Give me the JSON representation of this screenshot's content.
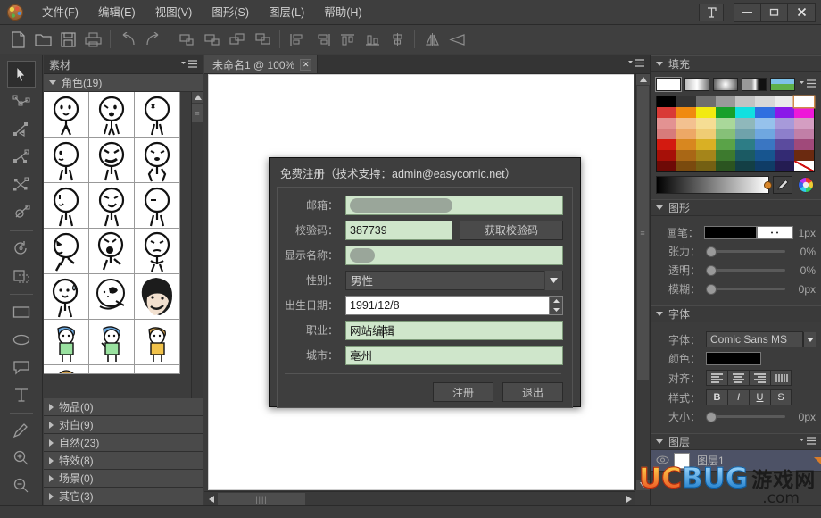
{
  "window": {
    "menu": [
      "文件(F)",
      "编辑(E)",
      "视图(V)",
      "图形(S)",
      "图层(L)",
      "帮助(H)"
    ],
    "controls": {
      "text_tool": "T",
      "minimize": "—",
      "maximize": "□",
      "close": "✕"
    }
  },
  "toolbar": {
    "icons": [
      "new-file",
      "open-folder",
      "save",
      "print",
      "undo",
      "redo",
      "group",
      "ungroup",
      "bring-forward",
      "send-backward",
      "align-left",
      "align-right",
      "align-top",
      "align-bottom",
      "align-center",
      "flip-horizontal",
      "flip-vertical"
    ]
  },
  "tools": {
    "items": [
      "select-arrow",
      "path-node",
      "line-arrow",
      "polyline",
      "star-node",
      "pen-circle",
      "rotate",
      "crop",
      "rectangle",
      "ellipse",
      "speech-bubble",
      "text",
      "eyedropper",
      "zoom-in",
      "zoom-out"
    ]
  },
  "material_panel": {
    "title": "素材",
    "open_group": {
      "label": "角色(19)"
    },
    "categories": [
      {
        "label": "物品(0)"
      },
      {
        "label": "对白(9)"
      },
      {
        "label": "自然(23)"
      },
      {
        "label": "特效(8)"
      },
      {
        "label": "场景(0)"
      },
      {
        "label": "其它(3)"
      }
    ]
  },
  "document": {
    "tab_label": "未命名1 @ 100%",
    "tab_close": "✕"
  },
  "fill_panel": {
    "title": "填充",
    "types": [
      "solid",
      "linear-gradient",
      "radial-gradient",
      "angular-gradient",
      "image-pattern"
    ],
    "selected_type": "solid",
    "swatch_rows": [
      [
        "#000000",
        "#343434",
        "#6e6e6e",
        "#9a9a9a",
        "#c3c3c3",
        "#d8d8d8",
        "#ebebeb",
        "#ffffff"
      ],
      [
        "#d93a36",
        "#f08a10",
        "#f2ea10",
        "#18a02a",
        "#11e0e0",
        "#2f6fe0",
        "#8a18e8",
        "#ee18d8"
      ],
      [
        "#e39292",
        "#f3c190",
        "#f5dd94",
        "#a9d89a",
        "#8fb8bb",
        "#96c2ec",
        "#a79ada",
        "#d49ec2"
      ],
      [
        "#d77b7b",
        "#eda866",
        "#efcc74",
        "#86c078",
        "#6fa2ab",
        "#6fa7e0",
        "#8d7fcb",
        "#c17fa7"
      ],
      [
        "#d31a10",
        "#d8871f",
        "#d9b024",
        "#5aa348",
        "#2d7d86",
        "#3a76c2",
        "#5b4b9e",
        "#a0497a"
      ],
      [
        "#a61008",
        "#a96715",
        "#a5851a",
        "#3d7a2e",
        "#1b5a63",
        "#17558f",
        "#332a73",
        "#6b2a10"
      ],
      [
        "#6e0a06",
        "#7a4a0e",
        "#746013",
        "#2b5420",
        "#133f45",
        "#0f3c66",
        "#241c52",
        "#ffffff"
      ]
    ],
    "selected_swatch": "#ffffff"
  },
  "shape_panel": {
    "title": "图形",
    "rows": [
      {
        "label": "画笔：",
        "type": "brush",
        "value": "1px"
      },
      {
        "label": "张力：",
        "type": "slider",
        "value": "0%",
        "pos": 0
      },
      {
        "label": "透明：",
        "type": "slider",
        "value": "0%",
        "pos": 0
      },
      {
        "label": "模糊：",
        "type": "slider",
        "value": "0px",
        "pos": 0
      }
    ]
  },
  "font_panel": {
    "title": "字体",
    "font_label": "字体：",
    "font_value": "Comic Sans MS",
    "color_label": "颜色：",
    "color_value": "#000000",
    "align_label": "对齐：",
    "align_options": [
      "align-left",
      "align-center",
      "align-right",
      "align-justify"
    ],
    "style_label": "样式：",
    "style_options": [
      "B",
      "I",
      "U",
      "S"
    ],
    "size_label": "大小：",
    "size_value": "0px"
  },
  "layer_panel": {
    "title": "图层",
    "layers": [
      {
        "name": "图层1",
        "visible": true
      }
    ]
  },
  "dialog": {
    "title": "免费注册（技术支持：admin@easycomic.net）",
    "fields": [
      {
        "label": "邮箱：",
        "value": "",
        "kind": "redacted"
      },
      {
        "label": "校验码：",
        "value": "387739",
        "kind": "text-with-button",
        "button": "获取校验码"
      },
      {
        "label": "显示名称：",
        "value": "",
        "kind": "redacted-small"
      },
      {
        "label": "性别：",
        "value": "男性",
        "kind": "select"
      },
      {
        "label": "出生日期：",
        "value": "1991/12/8",
        "kind": "spinner"
      },
      {
        "label": "职业：",
        "value": "网站编辑",
        "kind": "text-caret"
      },
      {
        "label": "城市：",
        "value": "亳州",
        "kind": "text"
      }
    ],
    "buttons": {
      "submit": "注册",
      "exit": "退出"
    }
  },
  "watermark": {
    "uc": "UC",
    "bug": "BUG",
    "cn": "游戏网",
    "com": ".com"
  },
  "colors": {
    "window_bg": "#3c3c3c",
    "panel_header": "#343434",
    "input_green": "#cfe6cb",
    "accent_orange": "#d87c2a",
    "layer_selected": "#4d5266"
  }
}
